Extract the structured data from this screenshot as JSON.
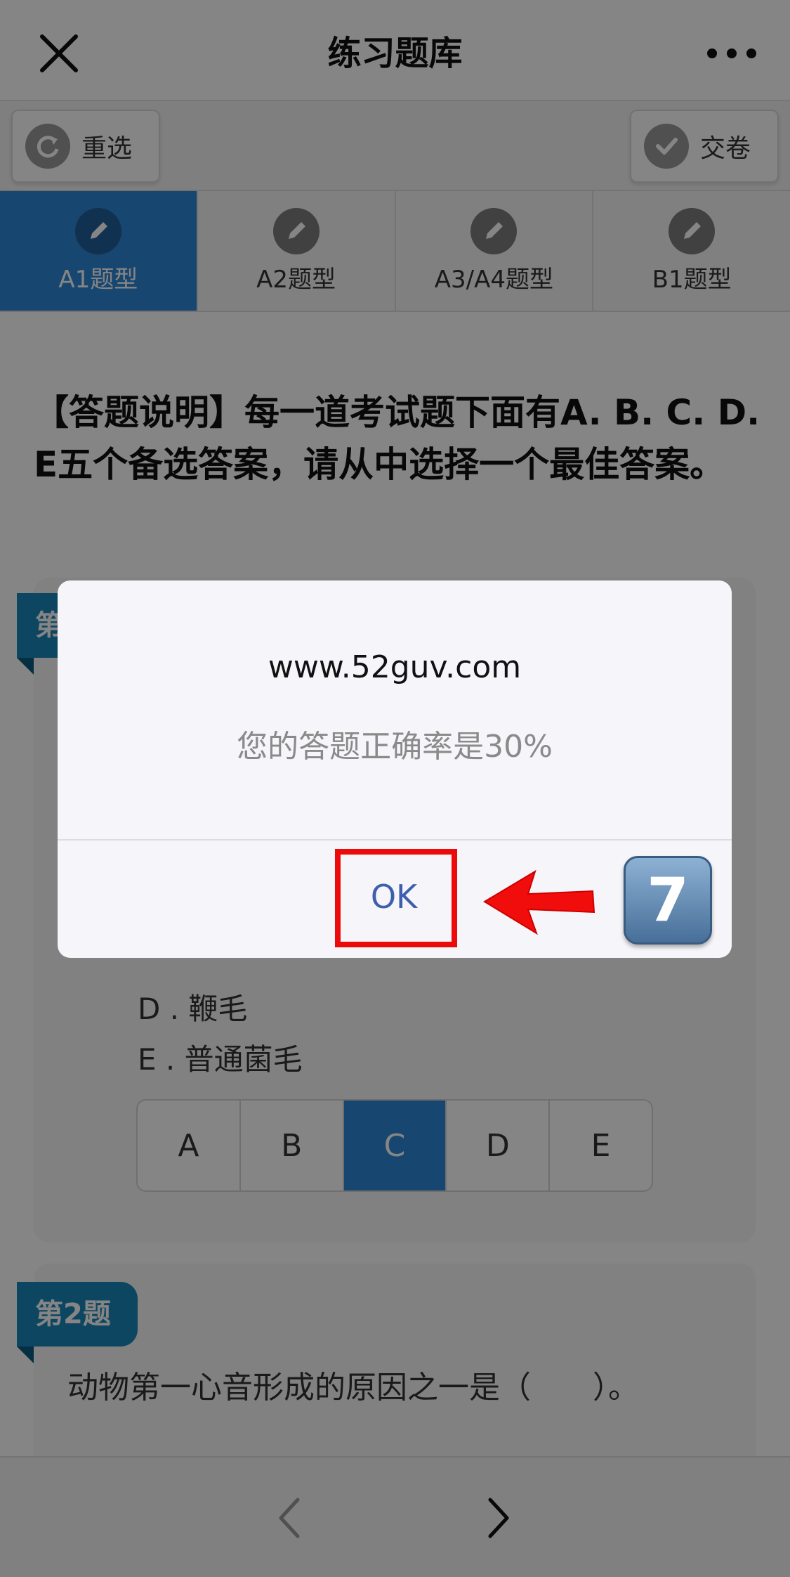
{
  "header": {
    "title": "练习题库"
  },
  "toolbar": {
    "reset_label": "重选",
    "submit_label": "交卷"
  },
  "tabs": [
    {
      "label": "A1题型",
      "active": true
    },
    {
      "label": "A2题型",
      "active": false
    },
    {
      "label": "A3/A4题型",
      "active": false
    },
    {
      "label": "B1题型",
      "active": false
    }
  ],
  "instructions": "【答题说明】每一道考试题下面有A. B. C. D. E五个备选答案，请从中选择一个最佳答案。",
  "question1": {
    "badge": "第",
    "visible_options": [
      {
        "label": "D . 鞭毛"
      },
      {
        "label": "E . 普通菌毛"
      }
    ],
    "answers": [
      "A",
      "B",
      "C",
      "D",
      "E"
    ],
    "selected": "C"
  },
  "question2": {
    "badge": "第2题",
    "text": "动物第一心音形成的原因之一是（　　）。"
  },
  "dialog": {
    "title": "www.52guv.com",
    "message": "您的答题正确率是30%",
    "ok_label": "OK"
  },
  "annotation": {
    "step": "7",
    "highlight_color": "#ec0a0a"
  },
  "colors": {
    "accent": "#2c87d6",
    "badge": "#1a86b9",
    "dialog_button": "#3e5fb0"
  }
}
